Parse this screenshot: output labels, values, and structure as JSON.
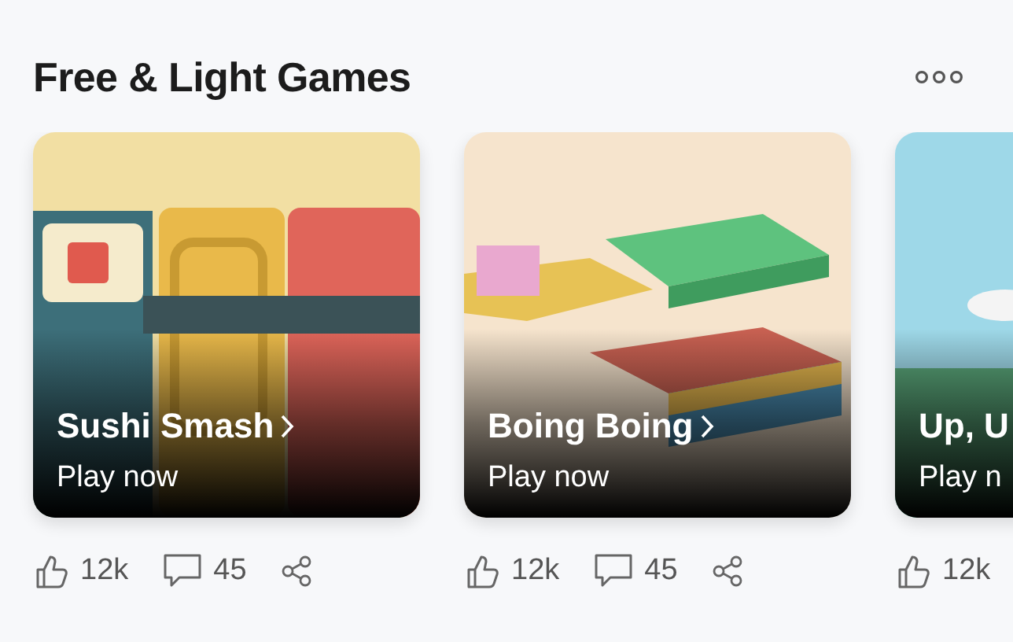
{
  "section": {
    "title": "Free & Light Games"
  },
  "cards": [
    {
      "kind": "sushi",
      "title": "Sushi Smash",
      "action": "Play now",
      "likes": "12k",
      "comments": "45"
    },
    {
      "kind": "boing",
      "title": "Boing Boing",
      "action": "Play now",
      "likes": "12k",
      "comments": "45"
    },
    {
      "kind": "sky",
      "title": "Up, U",
      "action": "Play n",
      "likes": "12k"
    }
  ]
}
